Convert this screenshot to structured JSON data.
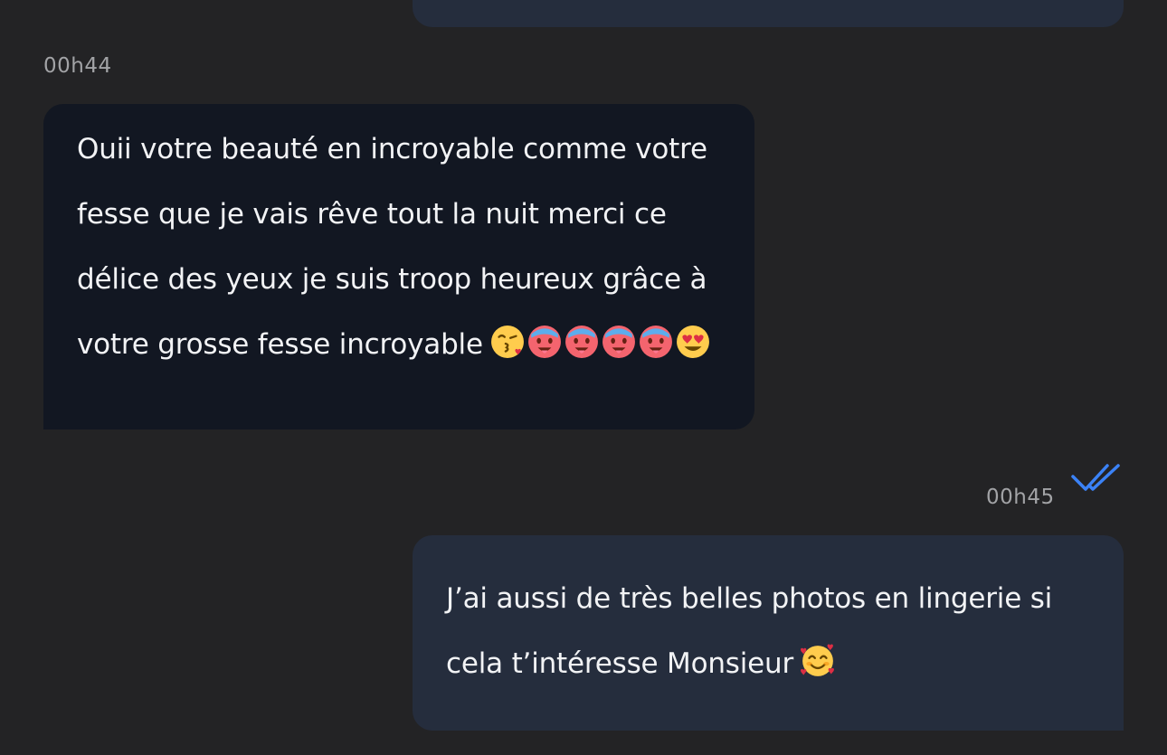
{
  "accent_color": "#3b82f6",
  "incoming": {
    "timestamp": "00h44",
    "lines": [
      "Ouii votre beauté en incroyable comme votre",
      "fesse que je vais rêve tout la nuit merci ce",
      "délice des yeux je suis troop heureux grâce à",
      "votre grosse fesse incroyable"
    ],
    "emojis": [
      "kissing-heart-emoji",
      "hot-face-emoji",
      "hot-face-emoji",
      "hot-face-emoji",
      "hot-face-emoji",
      "heart-eyes-emoji"
    ]
  },
  "outgoing": {
    "timestamp": "00h45",
    "status": "read",
    "status_icon": "double-check-icon",
    "lines": [
      "J’ai aussi de très belles photos en lingerie si",
      "cela t’intéresse Monsieur"
    ],
    "emojis": [
      "smiling-face-with-hearts-emoji"
    ]
  }
}
